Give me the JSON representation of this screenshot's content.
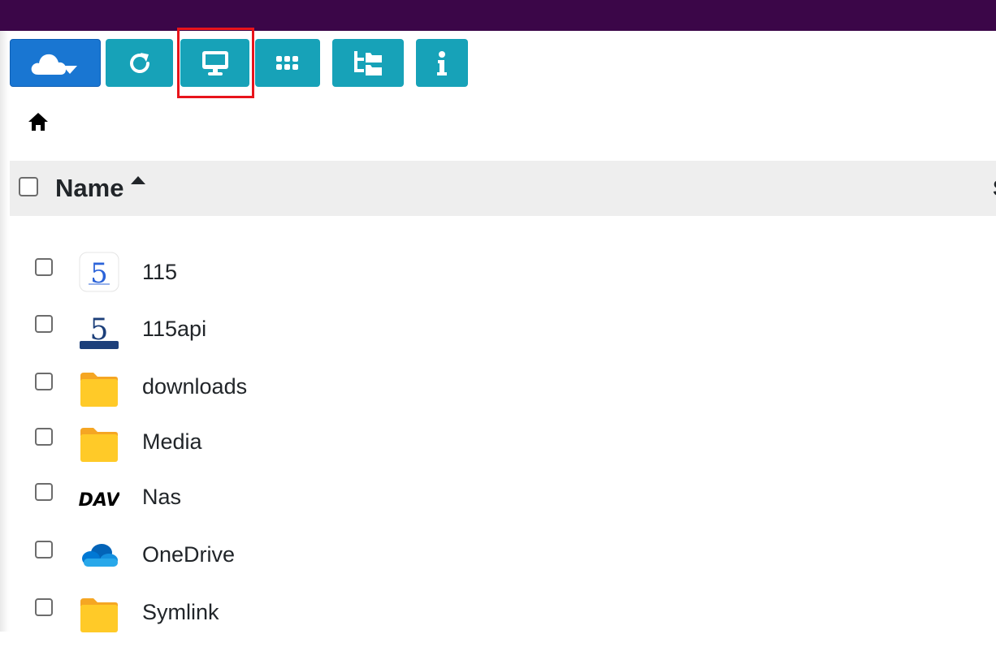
{
  "toolbar": {
    "buttons": [
      {
        "name": "cloud-menu-button",
        "icon": "cloud-caret-icon",
        "color": "#1976d2"
      },
      {
        "name": "refresh-button",
        "icon": "refresh-icon",
        "color": "#17a2b8"
      },
      {
        "name": "desktop-view-button",
        "icon": "desktop-icon",
        "color": "#17a2b8",
        "highlighted": true
      },
      {
        "name": "grid-view-button",
        "icon": "grid-icon",
        "color": "#17a2b8"
      },
      {
        "name": "tree-view-button",
        "icon": "folder-tree-icon",
        "color": "#17a2b8"
      },
      {
        "name": "info-button",
        "icon": "info-icon",
        "color": "#17a2b8"
      }
    ]
  },
  "breadcrumb": {
    "icon": "home-icon"
  },
  "table": {
    "name_header": "Name",
    "second_header_cut": "S",
    "sort": "ascending",
    "rows": [
      {
        "name": "115",
        "icon": "115-logo-icon"
      },
      {
        "name": "115api",
        "icon": "115-api-logo-icon"
      },
      {
        "name": "downloads",
        "icon": "folder-icon"
      },
      {
        "name": "Media",
        "icon": "folder-icon"
      },
      {
        "name": "Nas",
        "icon": "dav-logo-icon"
      },
      {
        "name": "OneDrive",
        "icon": "onedrive-icon"
      },
      {
        "name": "Symlink",
        "icon": "folder-icon"
      }
    ]
  },
  "colors": {
    "topbar": "#3b0648",
    "button": "#17a2b8",
    "primary": "#1976d2",
    "highlight": "#e8141b",
    "folder": "#ffca28"
  }
}
